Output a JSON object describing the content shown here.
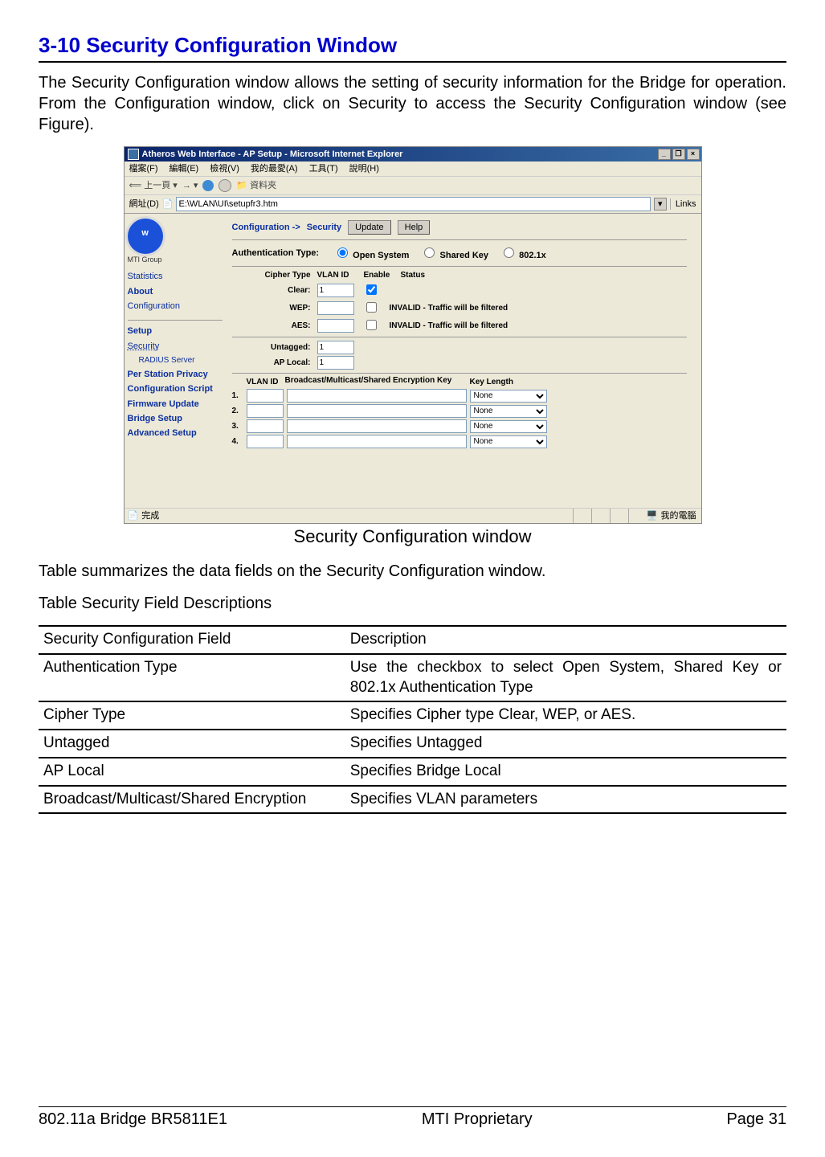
{
  "section": {
    "title": "3-10 Security Configuration Window"
  },
  "intro": "The Security Configuration window allows the setting of security information for the Bridge for operation. From the Configuration window, click on Security to access the Security Configuration window (see Figure).",
  "figure": {
    "caption": "Security Configuration window",
    "ie": {
      "title": "Atheros Web Interface - AP Setup - Microsoft Internet Explorer",
      "menus": [
        "檔案(F)",
        "編輯(E)",
        "檢視(V)",
        "我的最愛(A)",
        "工具(T)",
        "說明(H)"
      ],
      "toolbar_back": "上一頁",
      "toolbar_folders": "資料夾",
      "addr_label": "網址(D)",
      "address": "E:\\WLAN\\UI\\setupfr3.htm",
      "links_label": "Links",
      "status_done": "完成",
      "status_zone": "我的電腦"
    },
    "sidebar": {
      "logo_label": "MTI Group",
      "links_top": [
        "Statistics",
        "About",
        "Configuration"
      ],
      "links_bottom": [
        "Setup",
        "Security",
        "RADIUS Server",
        "Per Station Privacy",
        "Configuration Script",
        "Firmware Update",
        "Bridge Setup",
        "Advanced Setup"
      ]
    },
    "main": {
      "crumb_config": "Configuration ->",
      "crumb_security": "Security",
      "update_btn": "Update",
      "help_btn": "Help",
      "auth_label": "Authentication Type:",
      "auth_options": [
        "Open System",
        "Shared Key",
        "802.1x"
      ],
      "auth_selected": 0,
      "cipher_header": [
        "Cipher Type",
        "VLAN ID",
        "Enable",
        "Status"
      ],
      "cipher_rows": [
        {
          "label": "Clear:",
          "vlan": "1",
          "checked": true,
          "status": ""
        },
        {
          "label": "WEP:",
          "vlan": "",
          "checked": false,
          "status": "INVALID - Traffic will be filtered"
        },
        {
          "label": "AES:",
          "vlan": "",
          "checked": false,
          "status": "INVALID - Traffic will be filtered"
        }
      ],
      "untagged_label": "Untagged:",
      "untagged_val": "1",
      "aplocal_label": "AP Local:",
      "aplocal_val": "1",
      "key_header": [
        "",
        "VLAN ID",
        "Broadcast/Multicast/Shared Encryption Key",
        "Key Length"
      ],
      "key_rows": [
        {
          "num": "1.",
          "vlan": "",
          "key": "",
          "len": "None"
        },
        {
          "num": "2.",
          "vlan": "",
          "key": "",
          "len": "None"
        },
        {
          "num": "3.",
          "vlan": "",
          "key": "",
          "len": "None"
        },
        {
          "num": "4.",
          "vlan": "",
          "key": "",
          "len": "None"
        }
      ]
    }
  },
  "table_intro": "Table summarizes the data fields on the Security Configuration window.",
  "table_title": "Table Security Field Descriptions",
  "table": {
    "header": [
      "Security Configuration Field",
      "Description"
    ],
    "rows": [
      [
        "Authentication Type",
        "Use the checkbox to select Open System, Shared Key or 802.1x Authentication Type"
      ],
      [
        "Cipher Type",
        "Specifies Cipher type Clear, WEP, or AES."
      ],
      [
        "Untagged",
        "Specifies Untagged"
      ],
      [
        "AP Local",
        "Specifies Bridge Local"
      ],
      [
        "Broadcast/Multicast/Shared Encryption",
        "Specifies VLAN parameters"
      ]
    ]
  },
  "footer": {
    "left": "802.11a Bridge BR5811E1",
    "center": "MTI Proprietary",
    "right": "Page 31"
  }
}
